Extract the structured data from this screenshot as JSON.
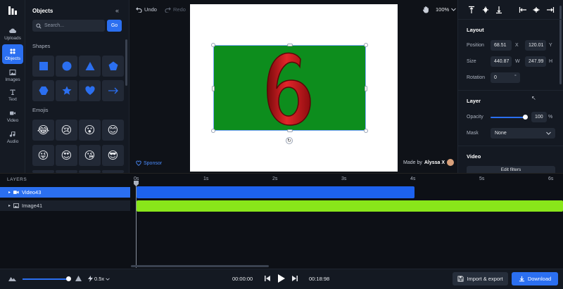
{
  "rail": {
    "items": [
      {
        "label": "Uploads",
        "icon": "cloud-upload-icon"
      },
      {
        "label": "Objects",
        "icon": "shapes-grid-icon"
      },
      {
        "label": "Images",
        "icon": "image-icon"
      },
      {
        "label": "Text",
        "icon": "text-icon"
      },
      {
        "label": "Video",
        "icon": "video-icon"
      },
      {
        "label": "Audio",
        "icon": "music-note-icon"
      }
    ]
  },
  "objects": {
    "title": "Objects",
    "search_placeholder": "Search...",
    "go_label": "Go",
    "shapes_title": "Shapes",
    "emojis_title": "Emojis",
    "emojis": [
      "😂",
      "😢",
      "😮",
      "😊",
      "😜",
      "😍",
      "😘",
      "😎"
    ]
  },
  "toolbar": {
    "undo": "Undo",
    "redo": "Redo",
    "zoom": "100%"
  },
  "canvas": {
    "glyph": "6",
    "sponsor": "Sponsor",
    "made_by_prefix": "Made by",
    "made_by_name": "Alyssa X"
  },
  "props": {
    "layout_title": "Layout",
    "position_label": "Position",
    "pos_x": "68.51",
    "pos_x_unit": "X",
    "pos_y": "120.01",
    "pos_y_unit": "Y",
    "size_label": "Size",
    "width": "440.87",
    "width_unit": "W",
    "height": "247.99",
    "height_unit": "H",
    "rotation_label": "Rotation",
    "rotation": "0",
    "rotation_unit": "°",
    "layer_title": "Layer",
    "opacity_label": "Opacity",
    "opacity": "100",
    "opacity_unit": "%",
    "opacity_level": 1.0,
    "mask_label": "Mask",
    "mask_value": "None",
    "video_title": "Video",
    "edit_filters": "Edit filters"
  },
  "timeline": {
    "layers_label": "LAYERS",
    "layers": [
      {
        "name": "Video43",
        "active": true
      },
      {
        "name": "Image41",
        "active": false
      }
    ],
    "ticks": [
      "0s",
      "1s",
      "2s",
      "3s",
      "4s",
      "5s",
      "6s"
    ]
  },
  "bottom": {
    "speed": "0.5x",
    "current_time": "00:00:00",
    "total_time": "00:18:98",
    "import_export": "Import & export",
    "download": "Download"
  },
  "colors": {
    "accent": "#2b6ff0",
    "clip_video": "#1d62ee",
    "clip_image": "#89e61a",
    "object_green": "#0d8d1d",
    "glyph_red": "#c8191b"
  }
}
